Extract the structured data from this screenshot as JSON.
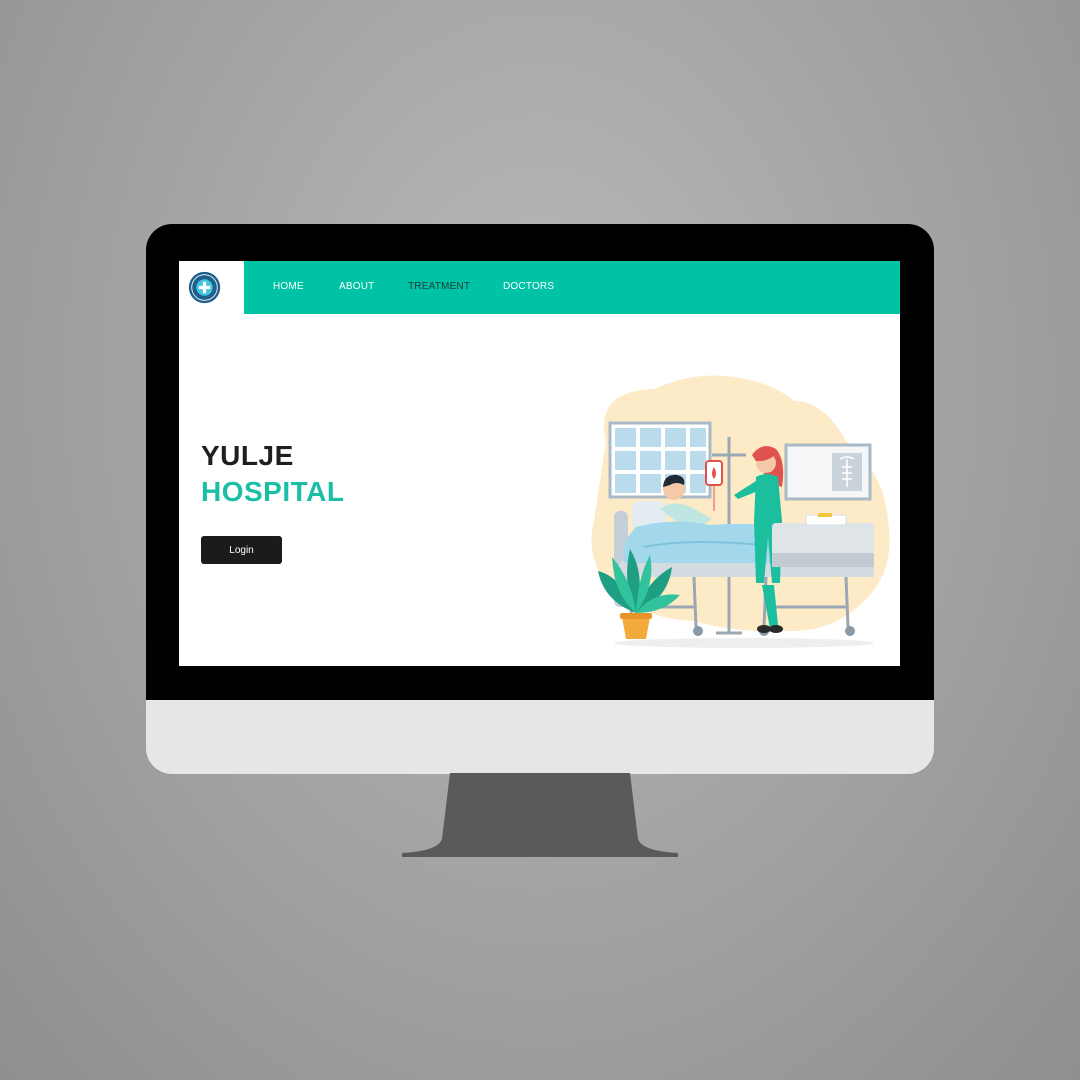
{
  "logo": {
    "icon": "hospital-cross-badge-icon",
    "lettering": "YULJE"
  },
  "nav": {
    "items": [
      {
        "label": "HOME"
      },
      {
        "label": "ABOUT"
      },
      {
        "label": "TREATMENT"
      },
      {
        "label": "DOCTORS"
      }
    ]
  },
  "hero": {
    "title_line1": "YULJE",
    "title_line2": "HOSPITAL",
    "login_label": "Login"
  },
  "illustration": {
    "icon": "patient-nurse-hospital-room-illustration"
  },
  "colors": {
    "accent": "#00c3a6",
    "title_accent": "#1bbfa6",
    "button": "#1b1b1b",
    "bezel": "#000000",
    "chin": "#e6e6e6",
    "stand": "#5a5a5a"
  }
}
